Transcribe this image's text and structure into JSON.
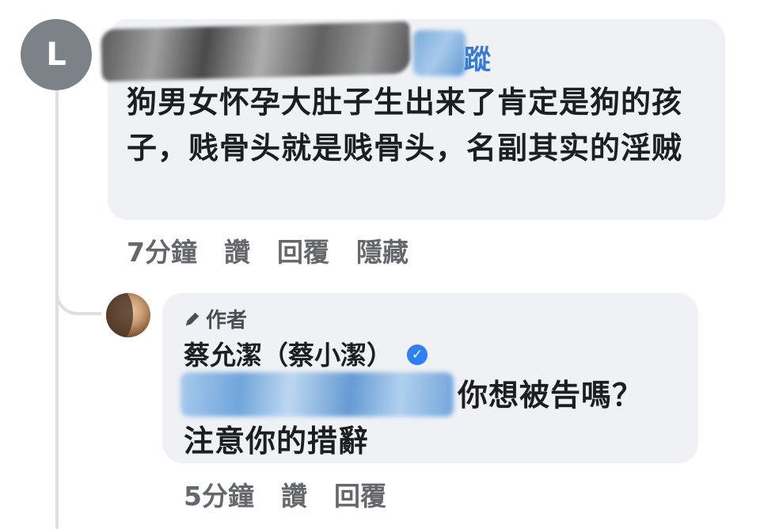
{
  "comment": {
    "avatar_letter": "L",
    "name_visible_suffix": "蹤",
    "text": "狗男女怀孕大肚子生出来了肯定是狗的孩子，贱骨头就是贱骨头，名副其实的淫贼",
    "time": "7分鐘",
    "like_label": "讚",
    "reply_label": "回覆",
    "hide_label": "隱藏"
  },
  "reply": {
    "author_tag": "作者",
    "author_name": "蔡允潔（蔡小潔）",
    "text_line1": "你想被告嗎？",
    "text_line2": "注意你的措辭",
    "time": "5分鐘",
    "like_label": "讚",
    "reply_label": "回覆"
  },
  "colors": {
    "bubble": "#eff1f5",
    "meta_text": "#65676b",
    "verified": "#2d7ff9",
    "link_blue": "#3879d9"
  },
  "icons": {
    "author_tag_icon": "pencil-icon",
    "verified_icon": "verified-badge-icon"
  }
}
